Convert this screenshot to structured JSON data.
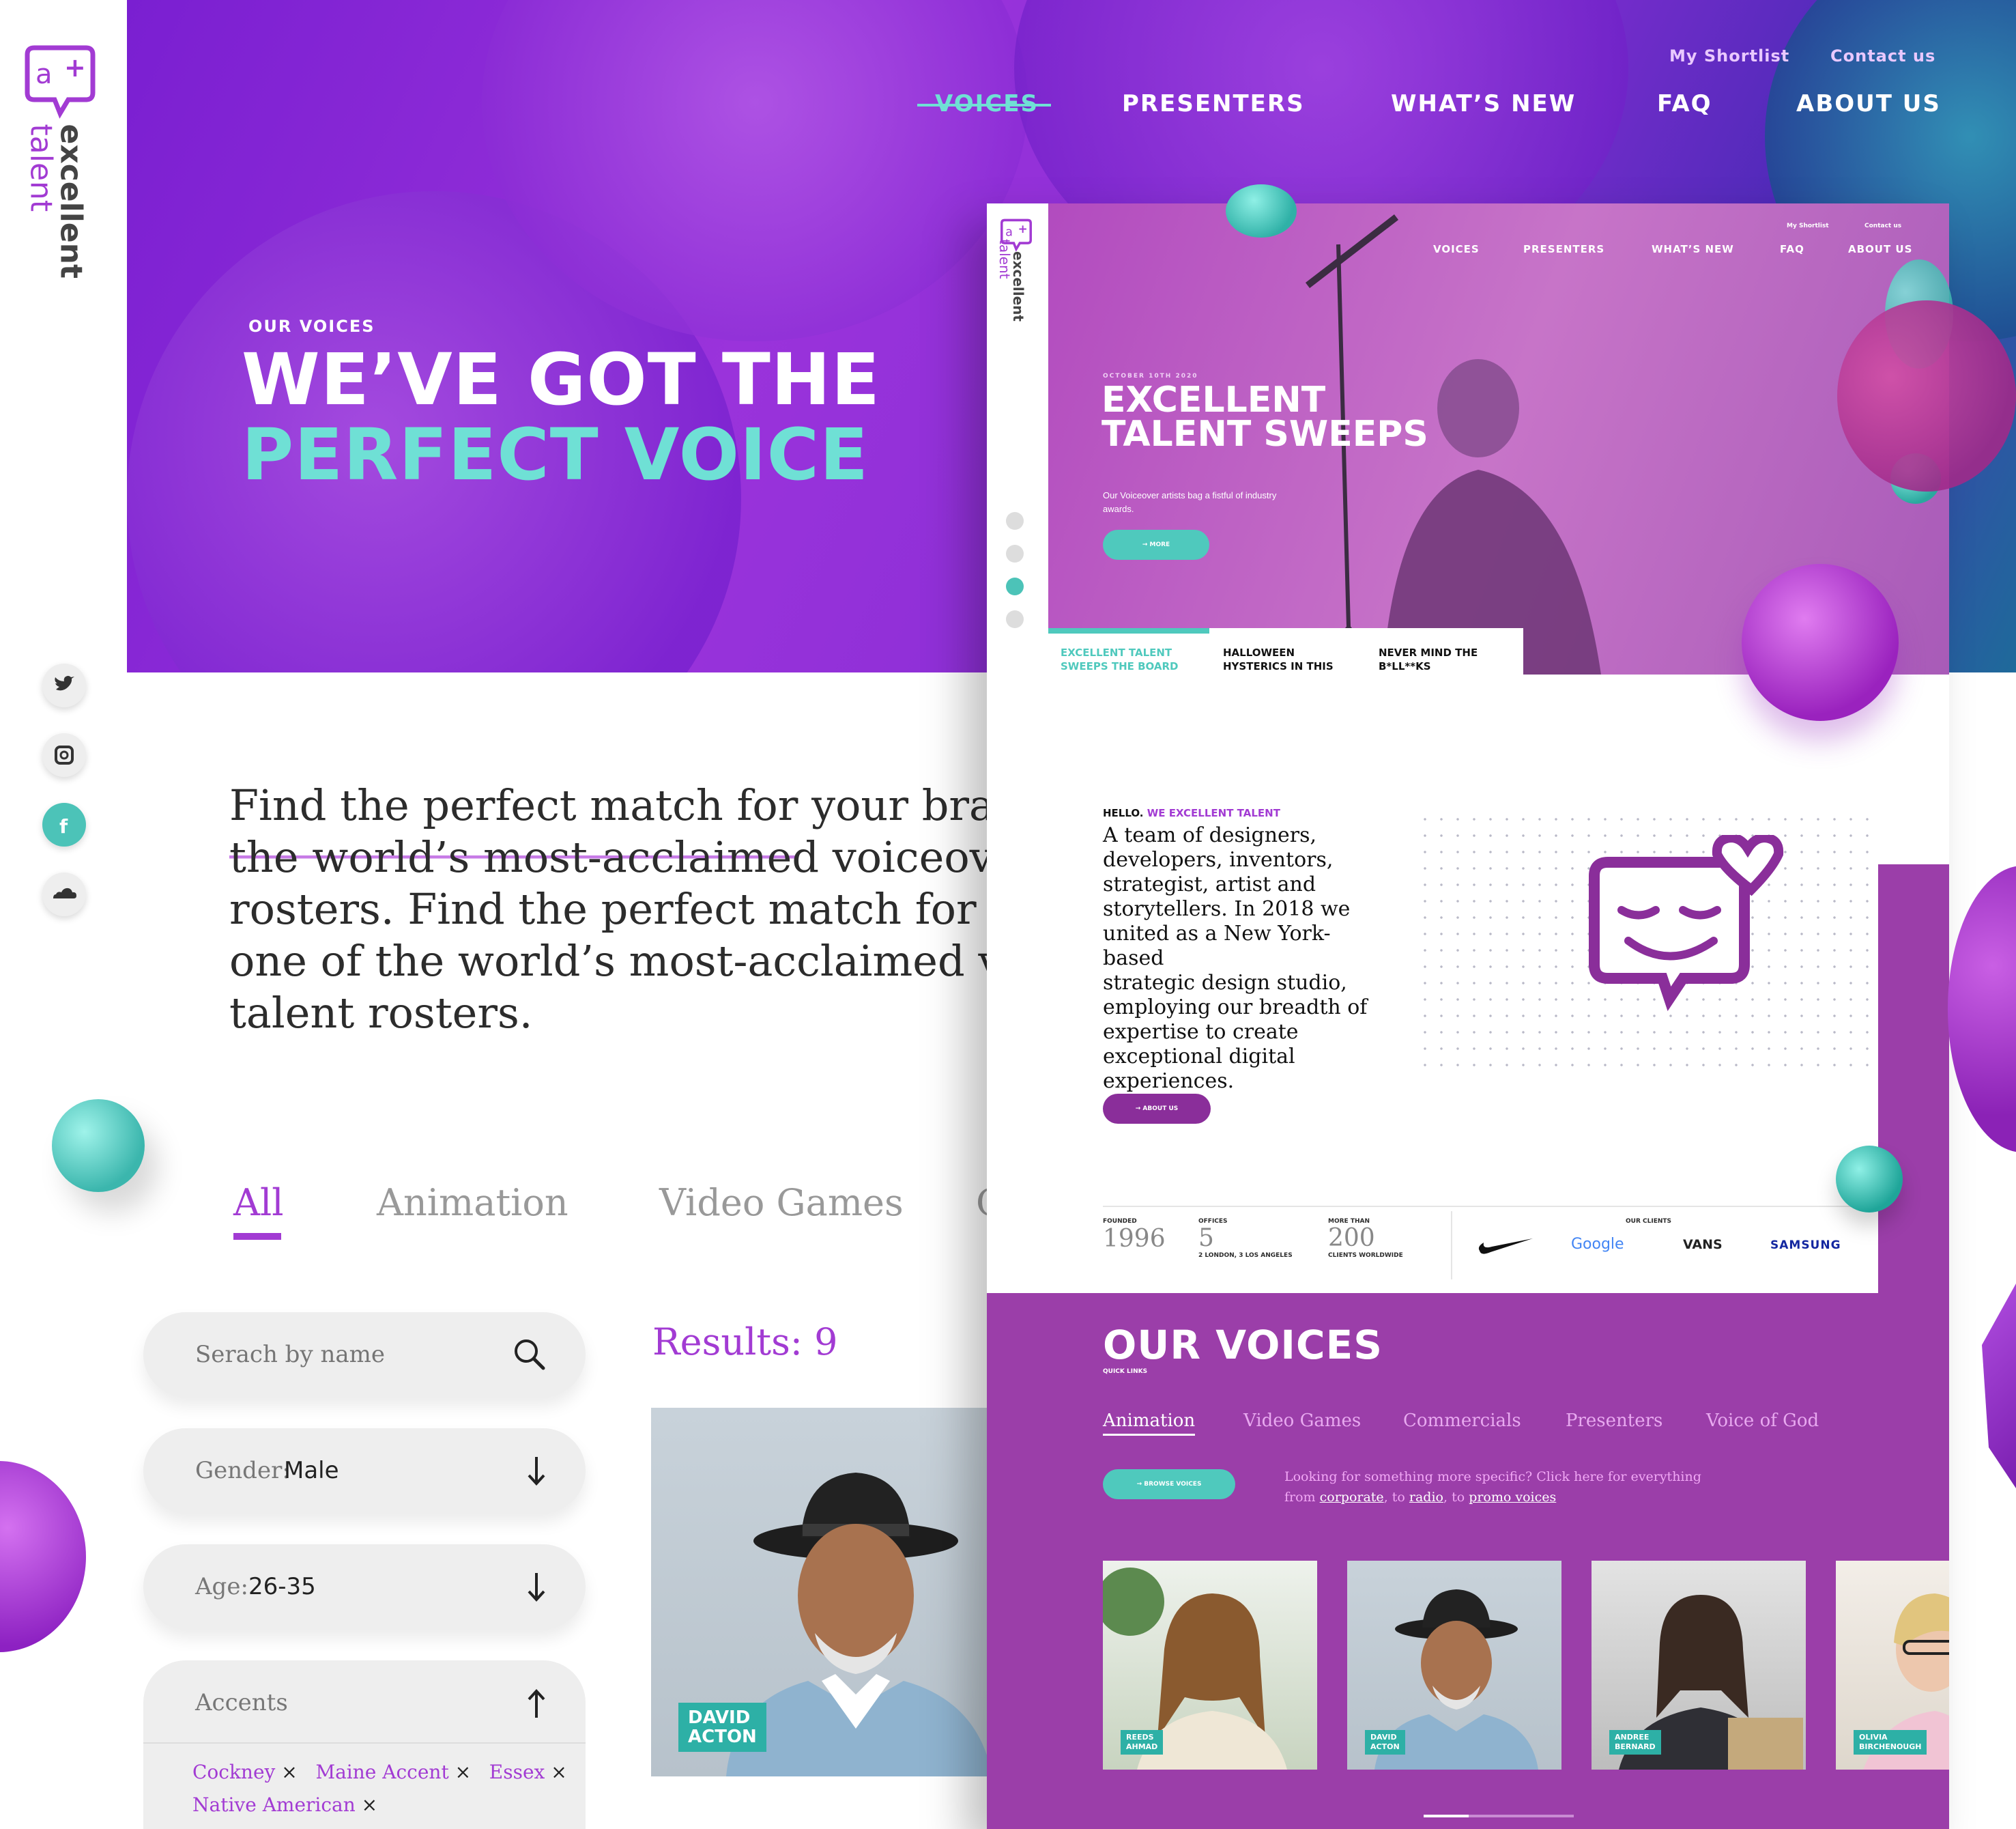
{
  "brand": {
    "line1": "excellent",
    "line2": "talent"
  },
  "header": {
    "utility": [
      "My Shortlist",
      "Contact us"
    ],
    "nav": [
      {
        "label": "VOICES",
        "active": true
      },
      {
        "label": "PRESENTERS"
      },
      {
        "label": "WHAT’S NEW"
      },
      {
        "label": "FAQ"
      },
      {
        "label": "ABOUT US"
      }
    ]
  },
  "hero": {
    "eyebrow": "OUR VOICES",
    "title_line1": "WE’VE GOT THE",
    "title_line2": "PERFECT VOICE"
  },
  "intro": {
    "lines": [
      "Find the perfect match for your brand",
      "the world’s most-acclaimed voiceove",
      "rosters. Find the perfect match for yo",
      "one of the world’s most-acclaimed vo",
      "talent rosters."
    ]
  },
  "filters": {
    "tabs": [
      {
        "label": "All",
        "active": true
      },
      {
        "label": "Animation"
      },
      {
        "label": "Video Games"
      },
      {
        "label": "C"
      }
    ],
    "search_placeholder": "Serach by name",
    "gender_label": "Gender:",
    "gender_value": "Male",
    "age_label": "Age:",
    "age_value": "26-35",
    "accents_label": "Accents",
    "accent_chips": [
      "Cockney",
      "Maine Accent",
      "Essex",
      "Native American"
    ]
  },
  "results": {
    "label": "Results: 9",
    "first_card_name": "DAVID\nACTON"
  },
  "social": [
    "twitter-icon",
    "instagram-icon",
    "facebook-icon",
    "soundcloud-icon"
  ],
  "inset": {
    "utility": [
      "My Shortlist",
      "Contact us"
    ],
    "nav": [
      "VOICES",
      "PRESENTERS",
      "WHAT’S NEW",
      "FAQ",
      "ABOUT US"
    ],
    "hero": {
      "date": "OCTOBER 10TH 2020",
      "title_line1": "EXCELLENT",
      "title_line2": "TALENT SWEEPS",
      "sub": "Our Voiceover artists bag a fistful of industry awards.",
      "button": "MORE"
    },
    "news_tabs": [
      "EXCELLENT TALENT\nSWEEPS THE BOARD",
      "HALLOWEEN\nHYSTERICS IN THIS",
      "NEVER MIND THE\nB*LL**KS"
    ],
    "about": {
      "hello": "HELLO.",
      "hello_accent": "WE EXCELLENT TALENT",
      "lines": [
        "A team of designers,",
        "developers, inventors,",
        "strategist, artist and",
        "storytellers. In 2018 we",
        "united as a New York-based",
        "strategic design studio,",
        "employing our breadth of",
        "expertise to create",
        "exceptional digital",
        "experiences."
      ],
      "button": "ABOUT US"
    },
    "stats": [
      {
        "label": "FOUNDED",
        "value": "1996",
        "sub": ""
      },
      {
        "label": "OFFICES",
        "value": "5",
        "sub": "2 LONDON, 3 LOS ANGELES"
      },
      {
        "label": "MORE THAN",
        "value": "200",
        "sub": "CLIENTS WORLDWIDE"
      }
    ],
    "clients_label": "OUR CLIENTS",
    "clients": [
      "Google",
      "VANS",
      "SAMSUNG"
    ],
    "voices": {
      "title": "OUR VOICES",
      "quick": "QUICK LINKS",
      "tabs": [
        {
          "label": "Animation",
          "active": true
        },
        {
          "label": "Video Games"
        },
        {
          "label": "Commercials"
        },
        {
          "label": "Presenters"
        },
        {
          "label": "Voice of God"
        }
      ],
      "browse": "BROWSE VOICES",
      "hint1": "Looking for something more specific? Click here for everything",
      "hint2_from": "from",
      "link1": "corporate",
      "hint2_to": ", to",
      "link2": "radio",
      "hint2_to2": ", to",
      "link3": "promo voices",
      "cards": [
        "REEDS\nAHMAD",
        "DAVID\nACTON",
        "ANDREE\nBERNARD",
        "OLIVIA\nBIRCHENOUGH"
      ]
    }
  },
  "colors": {
    "purple": "#9c34d3",
    "teal": "#6fe0d5",
    "inset_purple": "#9b3ea9",
    "accent_text": "#a23bd3"
  }
}
